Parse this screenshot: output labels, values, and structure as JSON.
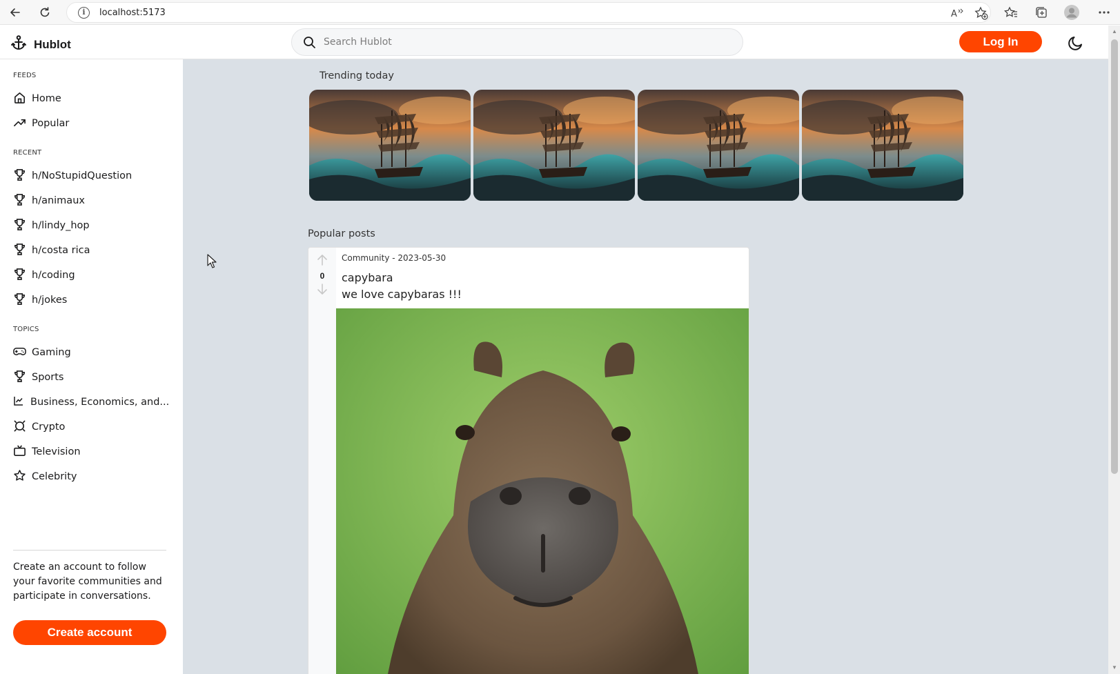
{
  "browser": {
    "url": "localhost:5173"
  },
  "header": {
    "brand": "Hublot",
    "search_placeholder": "Search Hublot",
    "login_label": "Log In"
  },
  "sidebar": {
    "feeds_title": "FEEDS",
    "feeds": [
      {
        "label": "Home",
        "icon": "home-icon"
      },
      {
        "label": "Popular",
        "icon": "trending-icon"
      }
    ],
    "recent_title": "RECENT",
    "recent": [
      {
        "label": "h/NoStupidQuestion",
        "icon": "trophy-icon"
      },
      {
        "label": "h/animaux",
        "icon": "trophy-icon"
      },
      {
        "label": "h/lindy_hop",
        "icon": "trophy-icon"
      },
      {
        "label": "h/costa rica",
        "icon": "trophy-icon"
      },
      {
        "label": "h/coding",
        "icon": "trophy-icon"
      },
      {
        "label": "h/jokes",
        "icon": "trophy-icon"
      }
    ],
    "topics_title": "TOPICS",
    "topics": [
      {
        "label": "Gaming",
        "icon": "gamepad-icon"
      },
      {
        "label": "Sports",
        "icon": "trophy-icon"
      },
      {
        "label": "Business, Economics, and...",
        "icon": "chart-icon"
      },
      {
        "label": "Crypto",
        "icon": "bitcoin-icon"
      },
      {
        "label": "Television",
        "icon": "tv-icon"
      },
      {
        "label": "Celebrity",
        "icon": "star-icon"
      }
    ],
    "promo_text": "Create an account to follow your favorite communities and participate in conversations.",
    "create_account_label": "Create account"
  },
  "main": {
    "trending_title": "Trending today",
    "trending_cards": [
      {
        "image": "pirate-ship-storm"
      },
      {
        "image": "pirate-ship-storm"
      },
      {
        "image": "pirate-ship-storm"
      },
      {
        "image": "pirate-ship-storm"
      }
    ],
    "popular_title": "Popular posts",
    "post": {
      "meta": "Community - 2023-05-30",
      "title": "capybara",
      "body": "we love capybaras !!!",
      "votes": "0",
      "image": "capybara-portrait"
    }
  },
  "colors": {
    "accent": "#ff4500",
    "main_bg": "#dae0e6"
  }
}
